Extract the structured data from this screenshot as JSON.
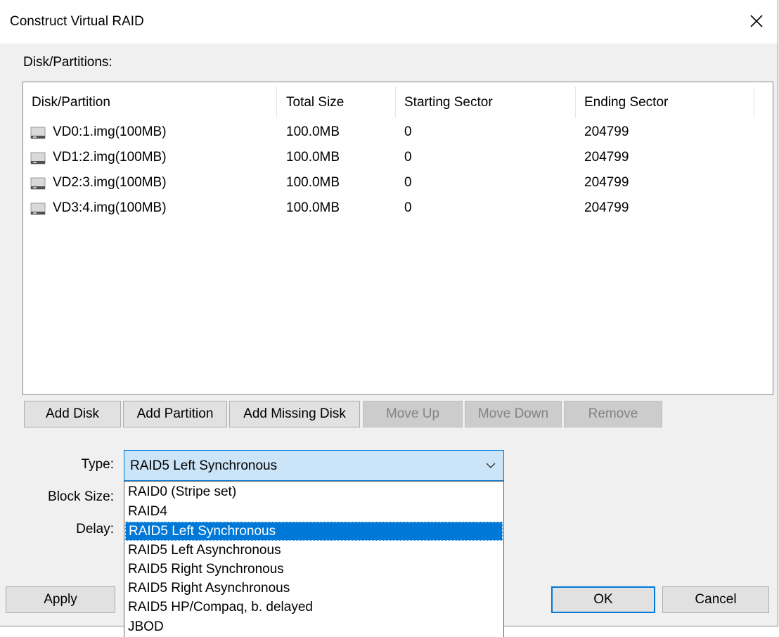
{
  "window": {
    "title": "Construct Virtual RAID"
  },
  "disk_group": {
    "label": "Disk/Partitions:",
    "columns": [
      "Disk/Partition",
      "Total Size",
      "Starting Sector",
      "Ending Sector"
    ],
    "rows": [
      [
        "VD0:1.img(100MB)",
        "100.0MB",
        "0",
        "204799"
      ],
      [
        "VD1:2.img(100MB)",
        "100.0MB",
        "0",
        "204799"
      ],
      [
        "VD2:3.img(100MB)",
        "100.0MB",
        "0",
        "204799"
      ],
      [
        "VD3:4.img(100MB)",
        "100.0MB",
        "0",
        "204799"
      ]
    ]
  },
  "buttons": {
    "add_disk": "Add Disk",
    "add_partition": "Add Partition",
    "add_missing_disk": "Add Missing Disk",
    "move_up": "Move Up",
    "move_down": "Move Down",
    "remove": "Remove",
    "apply": "Apply",
    "ok": "OK",
    "cancel": "Cancel"
  },
  "form": {
    "type_label": "Type:",
    "block_size_label": "Block Size:",
    "delay_label": "Delay:",
    "type_value": "RAID5 Left Synchronous",
    "type_options": [
      "RAID0 (Stripe set)",
      "RAID4",
      "RAID5 Left Synchronous",
      "RAID5 Left Asynchronous",
      "RAID5 Right Synchronous",
      "RAID5 Right Asynchronous",
      "RAID5 HP/Compaq, b. delayed",
      "JBOD"
    ]
  },
  "icons": {
    "disk": "disk-icon",
    "close": "close-icon",
    "dropdown": "chevron-down-icon"
  },
  "colors": {
    "accent": "#0078d7",
    "combo_bg": "#cce4f7",
    "dialog_bg": "#f0f0f0"
  }
}
